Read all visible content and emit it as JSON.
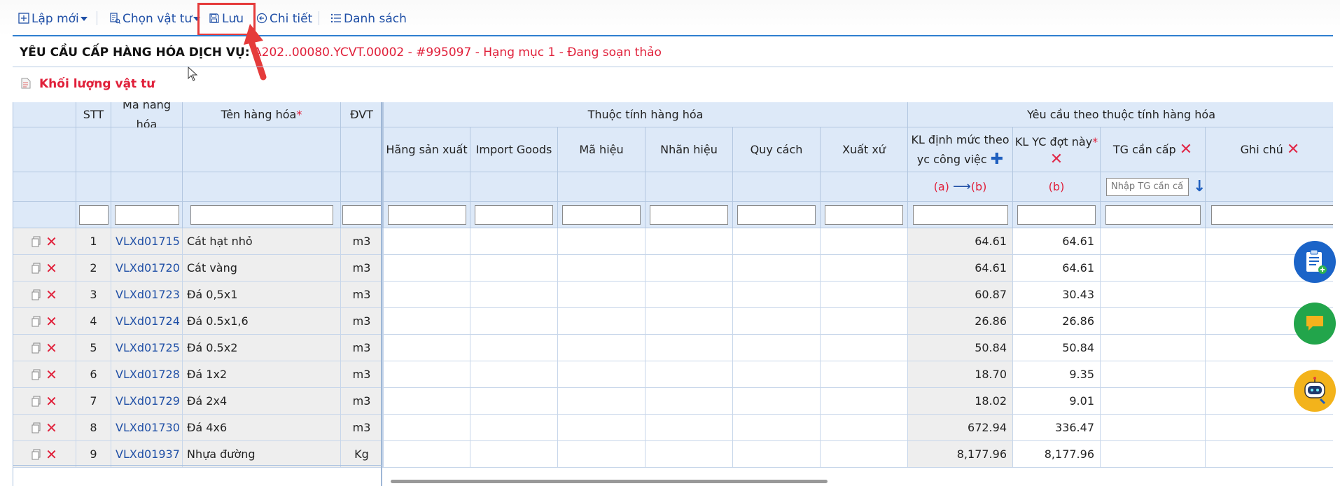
{
  "toolbar": {
    "new_label": "Lập mới",
    "choose_label": "Chọn vật tư",
    "save_label": "Lưu",
    "detail_label": "Chi tiết",
    "list_label": "Danh sách"
  },
  "header": {
    "title_label": "YÊU CẦU CẤP HÀNG HÓA DỊCH VỤ:",
    "title_value": "A202..00080.YCVT.00002 - #995097 - Hạng mục 1 - Đang soạn thảo"
  },
  "section": {
    "title": "Khối lượng vật tư"
  },
  "table": {
    "group_attr": "Thuộc tính hàng hóa",
    "group_req": "Yêu cầu theo thuộc tính hàng hóa",
    "col_stt": "STT",
    "col_code": "Mã hàng hóa",
    "col_name": "Tên hàng hóa",
    "col_unit": "ĐVT",
    "col_maker": "Hãng sản xuất",
    "col_import": "Import Goods",
    "col_sign": "Mã hiệu",
    "col_brand": "Nhãn hiệu",
    "col_spec": "Quy cách",
    "col_origin": "Xuất xứ",
    "col_norm_1": "KL định mức theo",
    "col_norm_2": "yc công việc",
    "col_req": "KL YC đợt này",
    "col_time": "TG cần cấp",
    "col_note": "Ghi chú",
    "marker_a": "(a)",
    "marker_b": "(b)",
    "marker_b2": "(b)",
    "time_placeholder": "Nhập TG cần cấp",
    "rows": [
      {
        "stt": "1",
        "code": "VLXd01715",
        "name": "Cát hạt nhỏ",
        "unit": "m3",
        "norm": "64.61",
        "req": "64.61"
      },
      {
        "stt": "2",
        "code": "VLXd01720",
        "name": "Cát vàng",
        "unit": "m3",
        "norm": "64.61",
        "req": "64.61"
      },
      {
        "stt": "3",
        "code": "VLXd01723",
        "name": "Đá 0,5x1",
        "unit": "m3",
        "norm": "60.87",
        "req": "30.43"
      },
      {
        "stt": "4",
        "code": "VLXd01724",
        "name": "Đá 0.5x1,6",
        "unit": "m3",
        "norm": "26.86",
        "req": "26.86"
      },
      {
        "stt": "5",
        "code": "VLXd01725",
        "name": "Đá 0.5x2",
        "unit": "m3",
        "norm": "50.84",
        "req": "50.84"
      },
      {
        "stt": "6",
        "code": "VLXd01728",
        "name": "Đá 1x2",
        "unit": "m3",
        "norm": "18.70",
        "req": "9.35"
      },
      {
        "stt": "7",
        "code": "VLXd01729",
        "name": "Đá 2x4",
        "unit": "m3",
        "norm": "18.02",
        "req": "9.01"
      },
      {
        "stt": "8",
        "code": "VLXd01730",
        "name": "Đá 4x6",
        "unit": "m3",
        "norm": "672.94",
        "req": "336.47"
      },
      {
        "stt": "9",
        "code": "VLXd01937",
        "name": "Nhựa đường",
        "unit": "Kg",
        "norm": "8,177.96",
        "req": "8,177.96"
      }
    ]
  },
  "fabs": {
    "fab1_icon": "clipboard-add-icon",
    "fab2_icon": "chat-icon",
    "fab3_icon": "robot-support-icon"
  }
}
